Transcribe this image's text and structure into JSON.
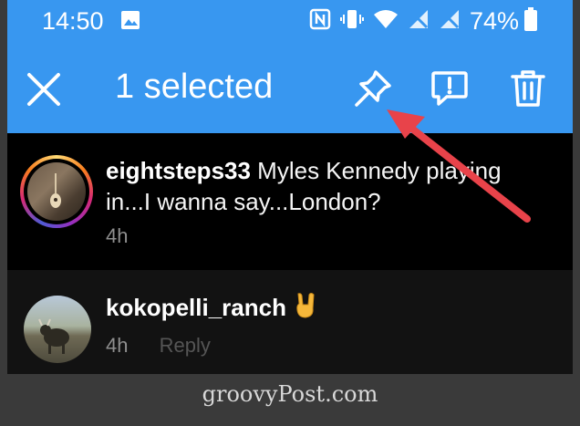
{
  "status_bar": {
    "time": "14:50",
    "battery_percent": "74%",
    "icons": [
      "gallery-icon",
      "nfc-icon",
      "vibrate-icon",
      "wifi-icon",
      "signal-off-icon",
      "signal-off-icon",
      "battery-icon"
    ]
  },
  "action_bar": {
    "selected_label": "1 selected",
    "color": "#3897f0"
  },
  "comments": [
    {
      "username": "eightsteps33",
      "text": " Myles Kennedy playing in...I wanna say...London?",
      "time": "4h"
    },
    {
      "username": "kokopelli_ranch",
      "text": "",
      "time": "4h",
      "reply_label": "Reply"
    }
  ],
  "annotation": {
    "arrow_color": "#e8434a"
  },
  "watermark": "groovyPost.com"
}
